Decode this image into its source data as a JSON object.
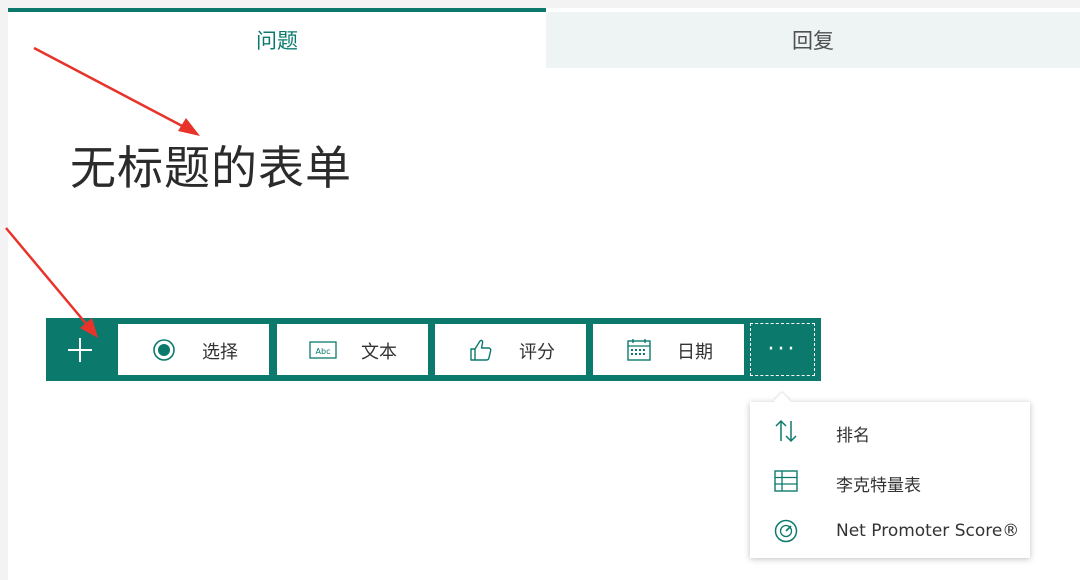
{
  "tabs": {
    "questions": "问题",
    "responses": "回复"
  },
  "form": {
    "title": "无标题的表单"
  },
  "toolbar": {
    "add_icon": "plus-icon",
    "choice": {
      "label": "选择",
      "icon": "radio-icon"
    },
    "text": {
      "label": "文本",
      "icon": "text-abc-icon"
    },
    "rating": {
      "label": "评分",
      "icon": "thumbs-up-icon"
    },
    "date": {
      "label": "日期",
      "icon": "calendar-icon"
    },
    "more": {
      "label": "···",
      "icon": "more-icon"
    }
  },
  "more_menu": {
    "items": [
      {
        "label": "排名",
        "icon": "sort-arrows-icon"
      },
      {
        "label": "李克特量表",
        "icon": "grid-table-icon"
      },
      {
        "label": "Net Promoter Score®",
        "icon": "gauge-icon"
      }
    ]
  },
  "colors": {
    "accent": "#0b7a6d",
    "annotation_arrow": "#e8332a"
  }
}
